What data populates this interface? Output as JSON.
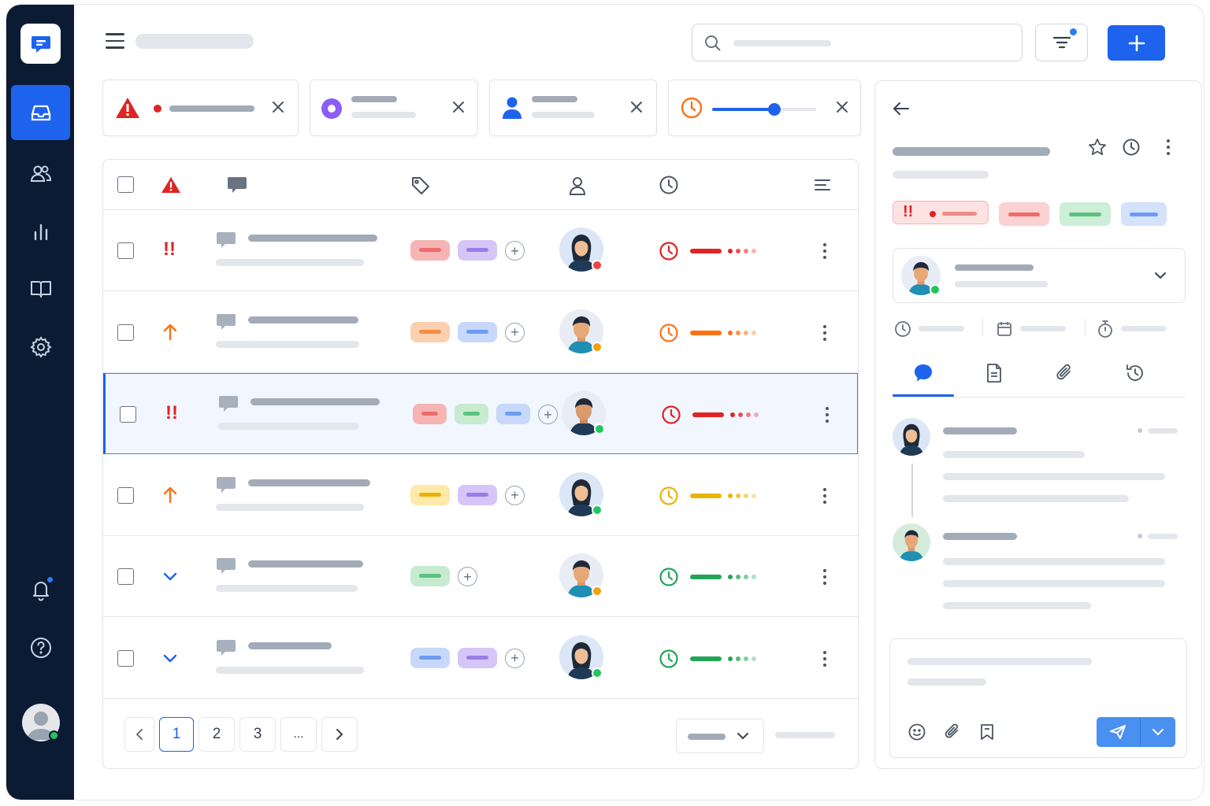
{
  "colors": {
    "sidebar_bg": "#0b1b33",
    "accent": "#1d63ed",
    "urgent": "#e02424",
    "high": "#f97316",
    "medium": "#eab308",
    "low": "#22a559",
    "online": "#22c55e",
    "away": "#f59e0b",
    "busy": "#ef4444"
  },
  "sidebar": {
    "items": [
      {
        "icon": "inbox-icon",
        "active": true
      },
      {
        "icon": "users-icon",
        "active": false
      },
      {
        "icon": "bar-chart-icon",
        "active": false
      },
      {
        "icon": "book-icon",
        "active": false
      },
      {
        "icon": "gear-icon",
        "active": false
      }
    ],
    "bottom": [
      "bell-icon",
      "help-icon",
      "user-avatar"
    ]
  },
  "filters": [
    {
      "icon": "alert-triangle-icon"
    },
    {
      "icon": "status-circle-icon"
    },
    {
      "icon": "user-icon"
    },
    {
      "icon": "clock-icon",
      "slider_value": 0.6
    }
  ],
  "table": {
    "columns": [
      "priority-icon",
      "message-icon",
      "tag-icon",
      "user-icon",
      "clock-icon",
      "sort-icon"
    ],
    "rows": [
      {
        "priority": "urgent",
        "tags": [
          "#f6b4b4",
          "#d6c5f7"
        ],
        "status": "busy",
        "sla": "urgent",
        "selected": false
      },
      {
        "priority": "high",
        "tags": [
          "#fbd0b0",
          "#c7d8fb"
        ],
        "status": "away",
        "sla": "high",
        "selected": false
      },
      {
        "priority": "urgent",
        "tags": [
          "#f6b4b4",
          "#c6ebcf",
          "#c7d8fb"
        ],
        "status": "online",
        "sla": "urgent",
        "selected": true
      },
      {
        "priority": "high",
        "tags": [
          "#fde9a8",
          "#d6c5f7"
        ],
        "status": "online",
        "sla": "medium",
        "selected": false
      },
      {
        "priority": "low",
        "tags": [
          "#c6ebcf"
        ],
        "status": "away",
        "sla": "low",
        "selected": false
      },
      {
        "priority": "low",
        "tags": [
          "#c7d8fb",
          "#d6c5f7"
        ],
        "status": "online",
        "sla": "low",
        "selected": false
      }
    ]
  },
  "pagination": {
    "pages": [
      "1",
      "2",
      "3",
      "..."
    ],
    "current": "1"
  },
  "panel": {
    "tabs": [
      "chat-icon",
      "document-icon",
      "paperclip-icon",
      "history-icon"
    ],
    "active_tab": "chat-icon"
  }
}
